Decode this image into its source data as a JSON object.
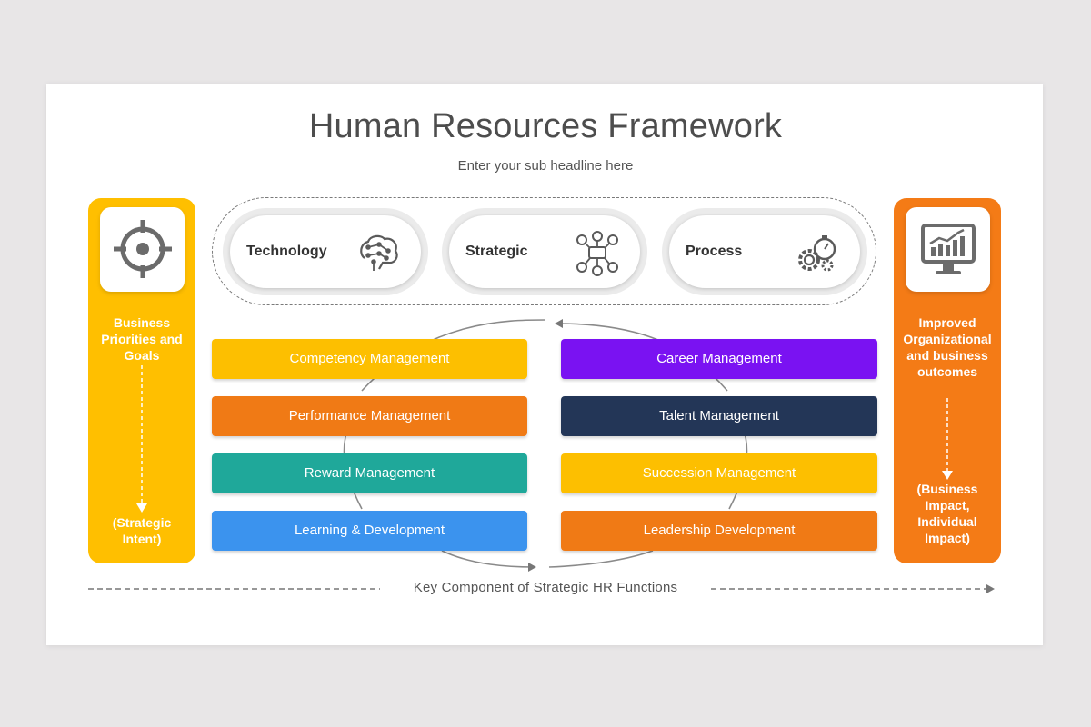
{
  "header": {
    "title": "Human Resources Framework",
    "subtitle": "Enter your sub headline here"
  },
  "left_panel": {
    "icon": "target-crosshair-icon",
    "top_text": "Business Priorities and Goals",
    "bottom_text": "(Strategic Intent)",
    "color": "#ffbf00"
  },
  "right_panel": {
    "icon": "monitor-chart-icon",
    "top_text": "Improved Organizational and business outcomes",
    "bottom_text": "(Business Impact, Individual Impact)",
    "color": "#f47b16"
  },
  "pillars": [
    {
      "label": "Technology",
      "icon": "brain-circuit-icon"
    },
    {
      "label": "Strategic",
      "icon": "strategy-network-icon"
    },
    {
      "label": "Process",
      "icon": "gears-stopwatch-icon"
    }
  ],
  "left_functions": [
    {
      "label": "Competency Management",
      "color": "#fdbf00"
    },
    {
      "label": "Performance Management",
      "color": "#f07a15"
    },
    {
      "label": "Reward Management",
      "color": "#1fa89a"
    },
    {
      "label": "Learning & Development",
      "color": "#3b93ee"
    }
  ],
  "right_functions": [
    {
      "label": "Career Management",
      "color": "#7a12f2"
    },
    {
      "label": "Talent Management",
      "color": "#233657"
    },
    {
      "label": "Succession Management",
      "color": "#fdbf00"
    },
    {
      "label": "Leadership Development",
      "color": "#f07a15"
    }
  ],
  "footer": {
    "label": "Key Component  of Strategic HR Functions"
  }
}
